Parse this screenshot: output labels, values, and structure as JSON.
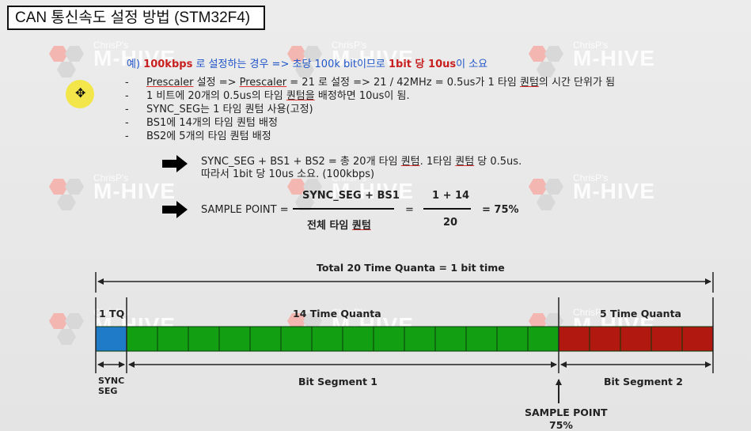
{
  "title": "CAN 통신속도 설정 방법 (STM32F4)",
  "watermark": {
    "small": "ChrisP's",
    "big": "M-HIVE"
  },
  "example": {
    "prefix": "예) ",
    "rate": "100kbps",
    "mid": " 로 설정하는 경우 => 초당 100k bit이므로 ",
    "bit": "1bit 당 10us",
    "suffix": "이 소요"
  },
  "bullets": {
    "b1a": "Prescaler",
    "b1b": " 설정 => ",
    "b1c": "Prescaler",
    "b1d": " = 21 로 설정 => 21 / 42MHz = 0.5us가 1 타임 ",
    "b1e": "퀀텀",
    "b1f": "의 시간 단위가 됨",
    "b2a": "1 비트에 20개의 0.5us의 타임 ",
    "b2b": "퀀텀을",
    "b2c": " 배정하면 10us이 됨.",
    "b3": "SYNC_SEG는 1 타임 퀀텀 사용(고정)",
    "b4": "BS1에 14개의 타임 퀀텀 배정",
    "b5": "BS2에 5개의 타임 퀀텀 배정",
    "dash": "-"
  },
  "sum": {
    "line1a": "SYNC_SEG + BS1 + BS2 = 총 20개 타임 ",
    "line1b": "퀀텀",
    "line1c": ". 1타임 ",
    "line1d": "퀀텀",
    "line1e": " 당 0.5us.",
    "line2": "따라서 1bit 당 10us 소요. (100kbps)"
  },
  "sample": {
    "label": "SAMPLE POINT =",
    "num1": "SYNC_SEG + BS1",
    "den1a": "전체 타임 ",
    "den1b": "퀀텀",
    "eq": "=",
    "num2": "1 + 14",
    "den2": "20",
    "result": "= 75%"
  },
  "diagram": {
    "total": "Total 20 Time Quanta  =  1 bit time",
    "tq1": "1 TQ",
    "tq14": "14 Time Quanta",
    "tq5": "5 Time Quanta",
    "sync1": "SYNC",
    "sync2": "SEG",
    "bs1": "Bit Segment 1",
    "bs2": "Bit Segment 2",
    "sp1": "SAMPLE POINT",
    "sp2": "75%",
    "quanta": {
      "sync": 1,
      "bs1": 14,
      "bs2": 5
    },
    "colors": {
      "sync": "#1f7bc8",
      "bs1": "#12a012",
      "bs2": "#b01810",
      "grid": "#0a3a0a"
    }
  }
}
